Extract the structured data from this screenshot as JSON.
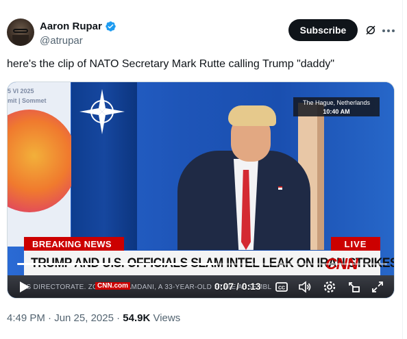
{
  "author": {
    "display_name": "Aaron Rupar",
    "handle": "@atrupar",
    "verified": true
  },
  "header": {
    "subscribe_label": "Subscribe"
  },
  "tweet": {
    "text": "here's the clip of NATO Secretary Mark Rutte calling Trump \"daddy\""
  },
  "video": {
    "summit_line1": "5 VI 2025",
    "summit_line2": "mit | Sommet",
    "location": "The Hague, Netherlands",
    "local_time": "10:40 AM",
    "breaking_label": "BREAKING NEWS",
    "live_label": "LIVE",
    "headline": "TRUMP AND U.S. OFFICIALS SLAM INTEL LEAK ON IRAN STRIKES",
    "network_logo": "CNN",
    "ticker_text": "NS DIRECTORATE.              ZOHRAN MAMDANI, A 33-YEAR-OLD STATE ASSEMBL",
    "ticker_cnn": "CNN.com",
    "player": {
      "current_time": "0:07",
      "duration": "0:13",
      "time_display": "0:07 / 0:13",
      "progress_fraction": 0.54
    }
  },
  "footer": {
    "time": "4:49 PM · Jun 25, 2025 · ",
    "views_count": "54.9K",
    "views_label": " Views"
  },
  "colors": {
    "accent_blue": "#1d9bf0",
    "breaking_red": "#cc0000",
    "text_primary": "#0f1419",
    "text_secondary": "#536471"
  }
}
